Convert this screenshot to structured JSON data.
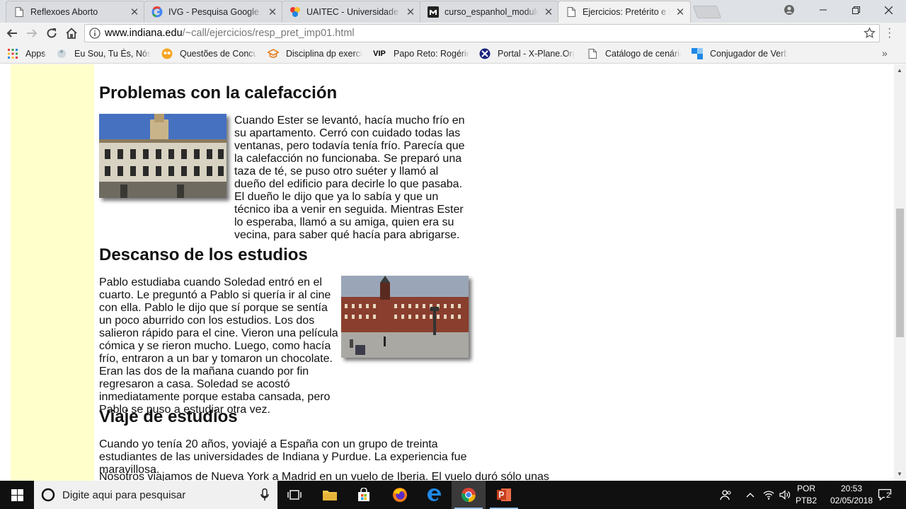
{
  "browser": {
    "tabs": [
      {
        "title": "Reflexoes Aborto",
        "icon": "page-icon"
      },
      {
        "title": "IVG - Pesquisa Google",
        "icon": "google-icon"
      },
      {
        "title": "UAITEC - Universidade Ab",
        "icon": "uaitec-icon"
      },
      {
        "title": "curso_espanhol_moduloB",
        "icon": "m-icon"
      },
      {
        "title": "Ejercicios: Pretérito e imp",
        "icon": "page-icon",
        "active": true
      }
    ],
    "url": {
      "host": "www.indiana.edu",
      "path": "/~call/ejercicios/resp_pret_imp01.html"
    },
    "bookmarks": [
      {
        "label": "Apps",
        "icon": "apps-grid-icon"
      },
      {
        "label": "Eu Sou, Tu És, Nós S",
        "icon": "globe-icon"
      },
      {
        "label": "Questões de Concurs",
        "icon": "owl-icon"
      },
      {
        "label": "Disciplina dp exercic",
        "icon": "hat-icon"
      },
      {
        "label": "Papo Reto: Rogério F",
        "icon": "vip-icon"
      },
      {
        "label": "Portal - X-Plane.Org",
        "icon": "xplane-icon"
      },
      {
        "label": "Catálogo de cenário",
        "icon": "page-icon"
      },
      {
        "label": "Conjugador de Verb",
        "icon": "blocks-icon"
      }
    ]
  },
  "page": {
    "sections": [
      {
        "heading": "Problemas con la calefacción",
        "text": "Cuando Ester se levantó, hacía mucho frío en su apartamento. Cerró con cuidado todas las ventanas, pero todavía tenía frío. Parecía que la calefacción no funcionaba. Se preparó una taza de té, se puso otro suéter y llamó al dueño del edificio para decirle lo que pasaba. El dueño le dijo que ya lo sabía y que un técnico iba a venir en seguida. Mientras Ester lo esperaba, llamó a su amiga, quien era su vecina, para saber qué hacía para abrigarse."
      },
      {
        "heading": "Descanso de los estudios",
        "text": "Pablo estudiaba cuando Soledad entró en el cuarto. Le preguntó a Pablo si quería ir al cine con ella. Pablo le dijo que sí porque se sentía un poco aburrido con los estudios. Los dos salieron rápido para el cine. Vieron una película cómica y se rieron mucho. Luego, como hacía frío, entraron a un bar y tomaron un chocolate. Eran las dos de la mañana cuando por fin regresaron a casa. Soledad se acostó inmediatamente porque estaba cansada, pero Pablo se puso a estudiar otra vez."
      },
      {
        "heading": "Viaje de estudios",
        "paragraphs": [
          "Cuando yo tenía 20 años, yoviajé a España con un grupo de treinta estudiantes de las universidades de Indiana y Purdue. La experiencia fue maravillosa.",
          "Nosotros viajamos de Nueva York a Madrid en un vuelo de Iberia. El vuelo duró sólo unas"
        ]
      }
    ]
  },
  "taskbar": {
    "search_placeholder": "Digite aqui para pesquisar",
    "lang_top": "POR",
    "lang_bottom": "PTB2",
    "time": "20:53",
    "date": "02/05/2018",
    "notifications": "2"
  },
  "colors": {
    "page_band": "#ffffcc",
    "taskbar": "#101010",
    "tabstrip": "#dee1e6"
  }
}
